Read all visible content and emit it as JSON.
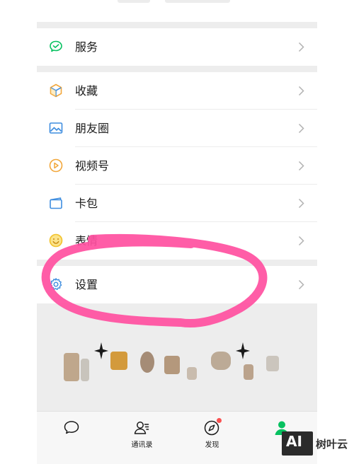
{
  "menu": [
    {
      "id": "services",
      "label": "服务",
      "icon": "wechat-pay-icon"
    },
    {
      "id": "favorites",
      "label": "收藏",
      "icon": "cube-icon"
    },
    {
      "id": "moments",
      "label": "朋友圈",
      "icon": "image-icon"
    },
    {
      "id": "channels",
      "label": "视频号",
      "icon": "play-circle-icon"
    },
    {
      "id": "cards",
      "label": "卡包",
      "icon": "wallet-icon"
    },
    {
      "id": "stickers",
      "label": "表情",
      "icon": "smiley-icon"
    },
    {
      "id": "settings",
      "label": "设置",
      "icon": "gear-icon"
    }
  ],
  "tabbar": {
    "chats_label": "",
    "contacts_label": "通讯录",
    "discover_label": "发现",
    "me_label": ""
  },
  "watermark": {
    "logo": "AI",
    "text": "树叶云"
  },
  "colors": {
    "accent_green": "#07c160",
    "highlight_circle": "#ff4fa0",
    "badge_red": "#fa5151"
  }
}
